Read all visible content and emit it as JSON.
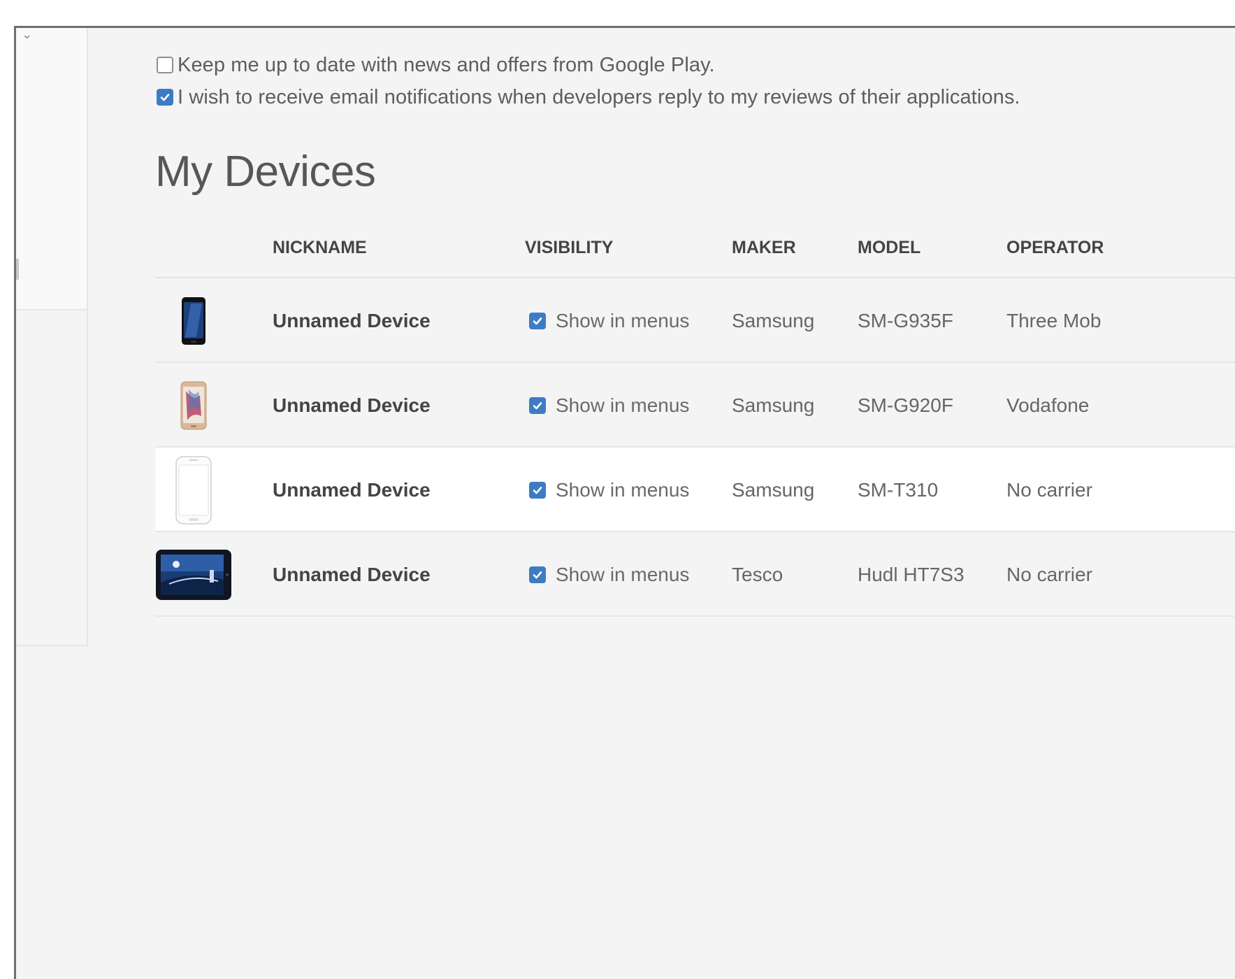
{
  "preferences": [
    {
      "label": "Keep me up to date with news and offers from Google Play.",
      "checked": false
    },
    {
      "label": "I wish to receive email notifications when developers reply to my reviews of their applications.",
      "checked": true
    }
  ],
  "section_title": "My Devices",
  "table": {
    "headers": {
      "nickname": "NICKNAME",
      "visibility": "VISIBILITY",
      "maker": "MAKER",
      "model": "MODEL",
      "operator": "OPERATOR"
    },
    "rows": [
      {
        "icon": "phone-dark-icon",
        "nickname": "Unnamed Device",
        "visibility": "Show in menus",
        "visible": true,
        "maker": "Samsung",
        "model": "SM-G935F",
        "operator": "Three Mob"
      },
      {
        "icon": "phone-gold-icon",
        "nickname": "Unnamed Device",
        "visibility": "Show in menus",
        "visible": true,
        "maker": "Samsung",
        "model": "SM-G920F",
        "operator": "Vodafone"
      },
      {
        "icon": "phone-white-icon",
        "nickname": "Unnamed Device",
        "visibility": "Show in menus",
        "visible": true,
        "maker": "Samsung",
        "model": "SM-T310",
        "operator": "No carrier"
      },
      {
        "icon": "tablet-icon",
        "nickname": "Unnamed Device",
        "visibility": "Show in menus",
        "visible": true,
        "maker": "Tesco",
        "model": "Hudl HT7S3",
        "operator": "No carrier"
      }
    ]
  },
  "colors": {
    "checkbox_accent": "#3d7cc4",
    "background": "#f4f4f4"
  }
}
